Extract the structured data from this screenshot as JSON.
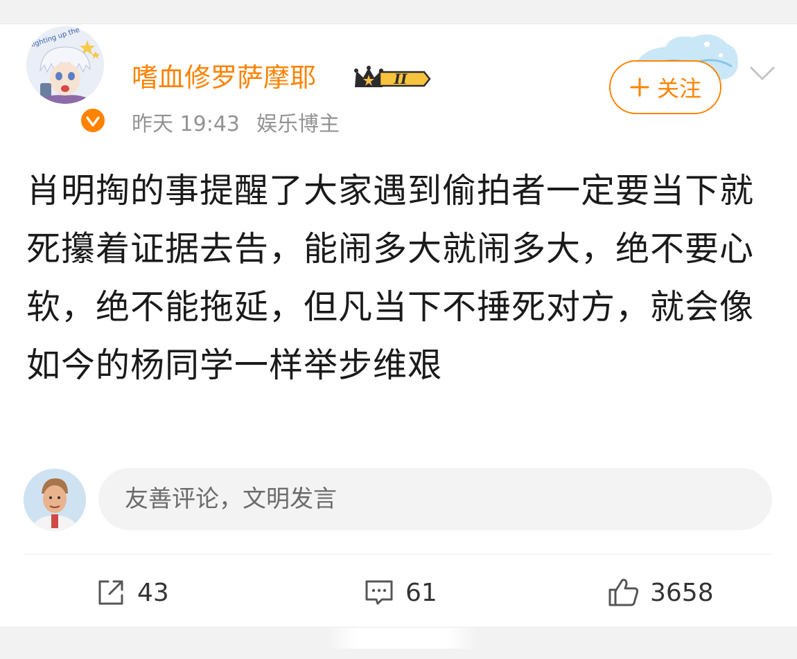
{
  "post": {
    "author": {
      "name": "嗜血修罗萨摩耶",
      "vip_level": "II",
      "avatar_caption": "lighting up the stars"
    },
    "meta": {
      "time": "昨天 19:43",
      "tag": "娱乐博主"
    },
    "follow_label": "关注",
    "text": "肖明掏的事提醒了大家遇到偷拍者一定要当下就死攥着证据去告，能闹多大就闹多大，绝不要心软，绝不能拖延，但凡当下不捶死对方，就会像如今的杨同学一样举步维艰"
  },
  "comment_box": {
    "placeholder": "友善评论，文明发言"
  },
  "actions": {
    "repost_count": "43",
    "comment_count": "61",
    "like_count": "3658"
  },
  "colors": {
    "accent": "#ff8200",
    "text": "#1a1a1a",
    "muted": "#939393"
  },
  "icons": [
    "verified-icon",
    "vip-crown-icon",
    "plus-icon",
    "chevron-down-icon",
    "repost-icon",
    "comment-icon",
    "like-icon"
  ]
}
